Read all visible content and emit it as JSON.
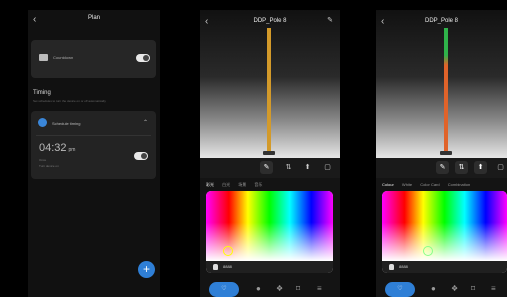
{
  "screen1": {
    "back_icon": "‹",
    "title": "Plan",
    "countdown_label": "Countdown",
    "timing_title": "Timing",
    "timing_subtitle": "Set schedules to turn the device on or off automatically",
    "schedule_label": "Schedule timing",
    "chevron": "⌃",
    "time": "04:32",
    "time_unit": "pm",
    "repeat_text": "Once",
    "action_text": "Turn device on",
    "add_label": "+"
  },
  "screen2": {
    "back_icon": "‹",
    "title": "DDP_Pole 8",
    "edit_icon": "✎",
    "tabs": [
      "✎",
      "⇅",
      "⬆",
      "▢"
    ],
    "modes": [
      "彩光",
      "白光",
      "场景",
      "音乐"
    ],
    "hex": "8888",
    "nav": [
      "♡",
      "●",
      "❖",
      "⌑",
      "≡"
    ],
    "pole_color": "#d39a2a"
  },
  "screen3": {
    "back_icon": "‹",
    "title": "DDP_Pole 8",
    "tabs": [
      "✎",
      "⇅",
      "⬆",
      "▢"
    ],
    "modes": [
      "Colour",
      "White",
      "Color Card",
      "Combination"
    ],
    "hex": "8888",
    "nav": [
      "♡",
      "●",
      "❖",
      "⌑",
      "≡"
    ],
    "pole_top_color": "#2fb34a",
    "pole_bottom_color": "#e0632a"
  },
  "colors": {
    "accent": "#2f7fd6"
  }
}
